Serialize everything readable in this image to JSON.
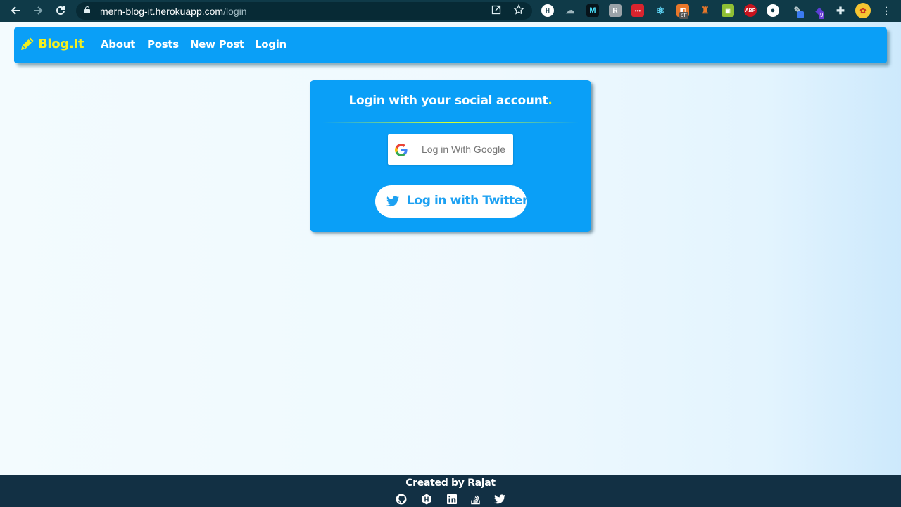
{
  "browser": {
    "url_host": "mern-blog-it.herokuapp.com",
    "url_path": "/login",
    "extensions": {
      "abp_label": "ABP",
      "off_badge": "off",
      "count_badge": "9"
    }
  },
  "navbar": {
    "brand": "Blog.It",
    "links": [
      "About",
      "Posts",
      "New Post",
      "Login"
    ]
  },
  "login_card": {
    "title": "Login with your social account",
    "title_dot": ".",
    "google_button": "Log in With Google",
    "twitter_button": "Log in with Twitter"
  },
  "footer": {
    "credit": "Created by Rajat",
    "social_icons": [
      "github-icon",
      "hackerrank-icon",
      "linkedin-icon",
      "stackoverflow-icon",
      "twitter-icon"
    ]
  },
  "colors": {
    "navbar_bg": "#0a9ff7",
    "brand_yellow": "#f2ef1f",
    "footer_bg": "#123044",
    "twitter_blue": "#1da1f2",
    "chrome_bg": "#0f3a48"
  }
}
